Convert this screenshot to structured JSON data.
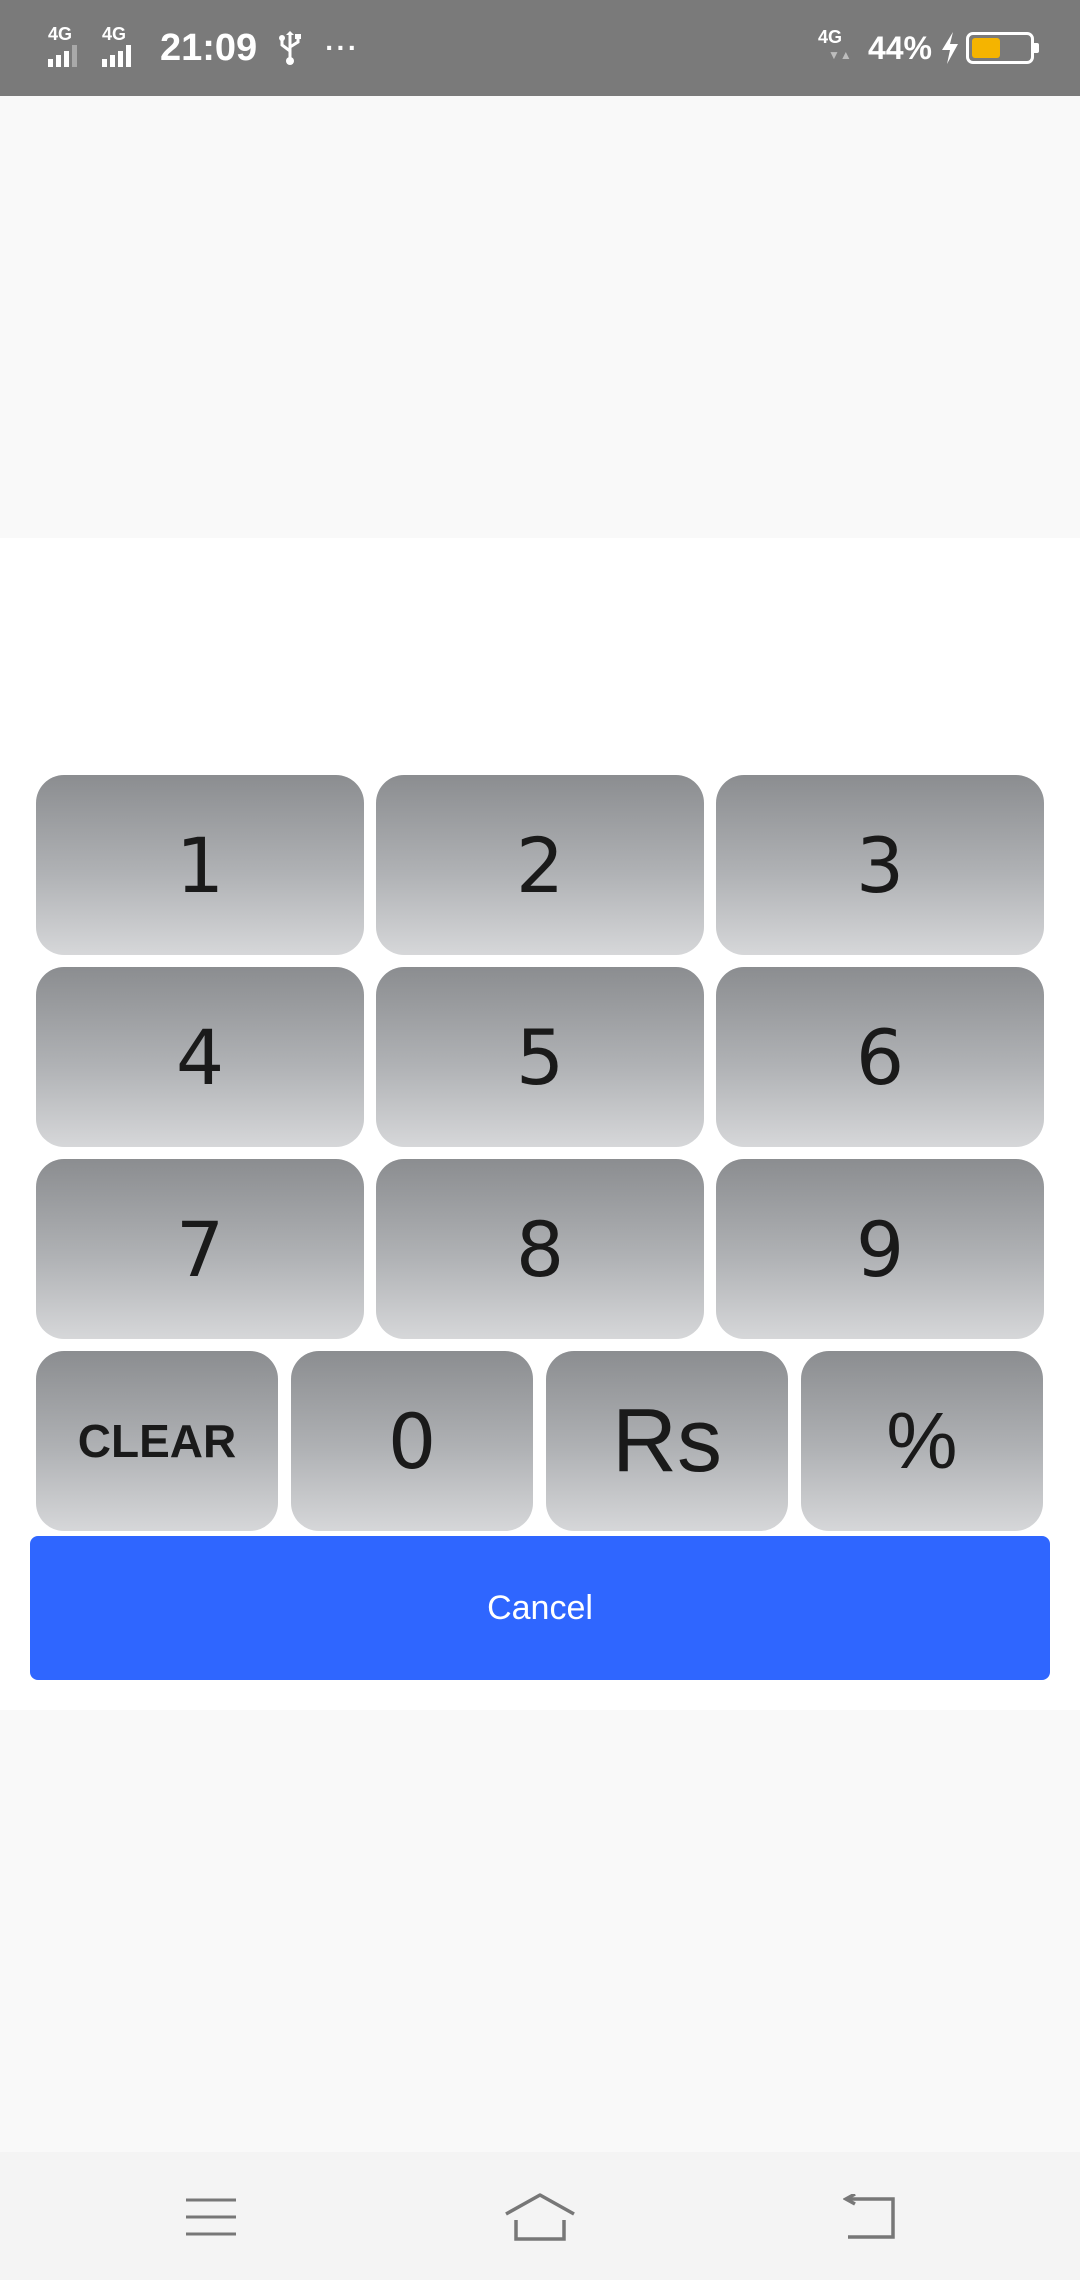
{
  "status_bar": {
    "network1": "4G",
    "network2": "4G",
    "time": "21:09",
    "dots": "···",
    "network3": "4G",
    "battery_percent": "44%",
    "battery_level": 0.44
  },
  "keypad": {
    "rows": [
      [
        "1",
        "2",
        "3"
      ],
      [
        "4",
        "5",
        "6"
      ],
      [
        "7",
        "8",
        "9"
      ]
    ],
    "bottom_row": [
      "CLEAR",
      "0",
      "Rs",
      "%"
    ]
  },
  "cancel_label": "Cancel",
  "nav": {
    "menu_icon": "menu-icon",
    "home_icon": "home-icon",
    "back_icon": "back-icon"
  },
  "colors": {
    "accent": "#2f66ff",
    "status_bar": "#7a7a7a",
    "battery": "#f5b400"
  }
}
